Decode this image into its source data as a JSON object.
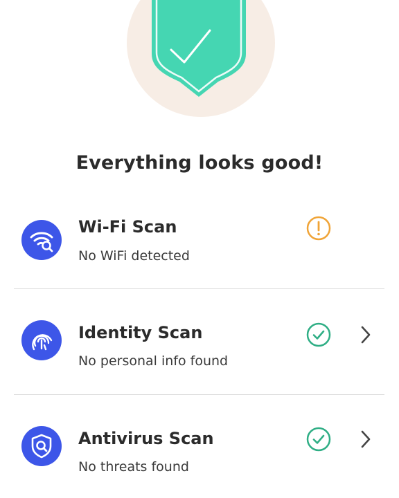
{
  "headline": "Everything looks good!",
  "colors": {
    "shield": "#45d6b2",
    "hero_bg": "#f7ede5",
    "icon_bg": "#3d56e8",
    "ok": "#2fae85",
    "warning": "#f0a437",
    "chevron": "#444444"
  },
  "scans": [
    {
      "title": "Wi-Fi Scan",
      "subtitle": "No WiFi detected",
      "status": "warning",
      "icon": "wifi-search-icon",
      "has_chevron": false
    },
    {
      "title": "Identity Scan",
      "subtitle": "No personal info found",
      "status": "ok",
      "icon": "fingerprint-icon",
      "has_chevron": true
    },
    {
      "title": "Antivirus Scan",
      "subtitle": "No threats found",
      "status": "ok",
      "icon": "shield-search-icon",
      "has_chevron": true
    }
  ]
}
